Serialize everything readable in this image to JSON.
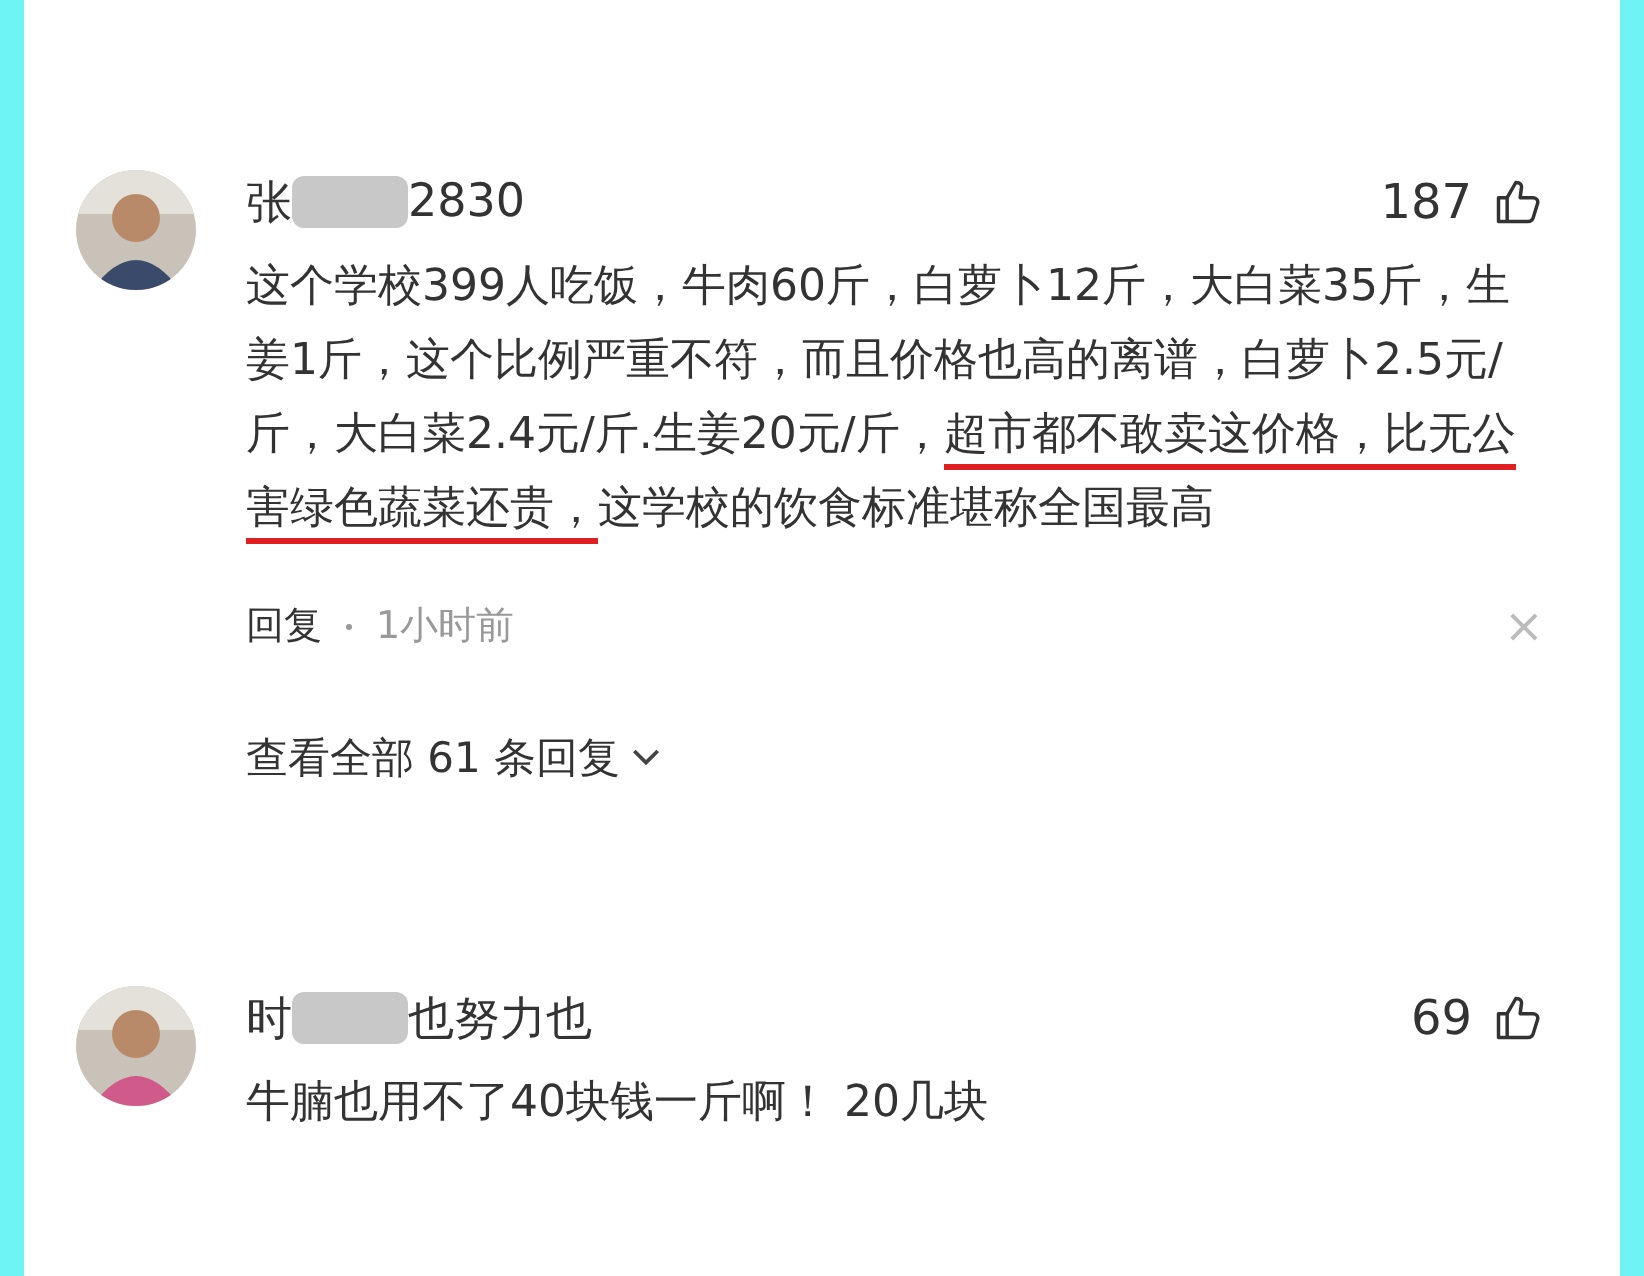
{
  "comments": [
    {
      "name_start": "张",
      "name_end": "2830",
      "name_blurred": true,
      "likes": "187",
      "body": [
        {
          "text": "这个学校399人吃饭，牛肉60斤，白萝卜12斤，大白菜35斤，生姜1斤，这个比例严重不符，而且价格也高的离谱，白萝卜2.5元/斤，大白菜2.4元/斤.生姜20元/斤，",
          "underlined": false
        },
        {
          "text": "超市都不敢卖这价格，比无公害绿色蔬菜还贵，",
          "underlined": true
        },
        {
          "text": "这学校的饮食标准堪称全国最高",
          "underlined": false
        }
      ],
      "reply": "回复",
      "time": "1小时前",
      "close": "×",
      "view_all": "查看全部 61 条回复"
    },
    {
      "name_start": "时",
      "name_end": "也努力也",
      "name_blurred": true,
      "likes": "69",
      "body": [
        {
          "text": "牛腩也用不了40块钱一斤啊！ 20几块",
          "underlined": false
        }
      ]
    }
  ]
}
